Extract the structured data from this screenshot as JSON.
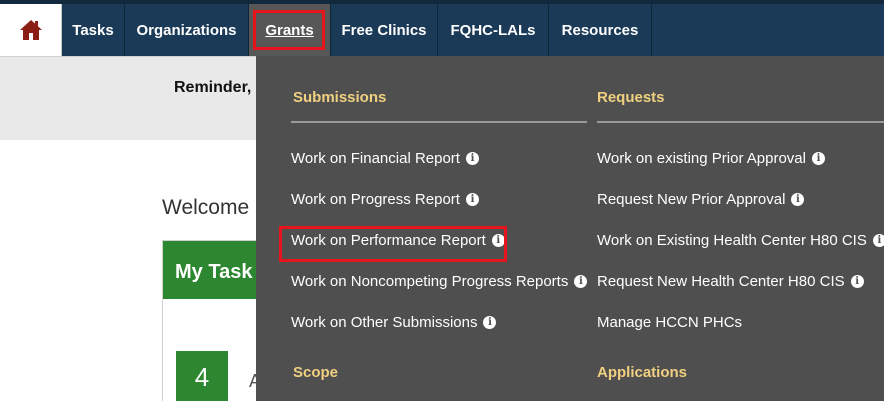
{
  "nav": {
    "home_icon": "home-icon",
    "items": [
      {
        "label": "Tasks"
      },
      {
        "label": "Organizations"
      },
      {
        "label": "Grants"
      },
      {
        "label": "Free Clinics"
      },
      {
        "label": "FQHC-LALs"
      },
      {
        "label": "Resources"
      }
    ],
    "active": "Grants",
    "colors": {
      "bar": "#1b3a57",
      "active": "#575757",
      "highlight": "#e8141c"
    }
  },
  "page": {
    "reminder": "Reminder,",
    "welcome": "Welcome",
    "tasks_card_title": "My Task",
    "task_count": "4",
    "task_count_next": "A",
    "card_color": "#2d8630"
  },
  "menu": {
    "submissions": {
      "heading": "Submissions",
      "items": [
        "Work on Financial Report",
        "Work on Progress Report",
        "Work on Performance Report",
        "Work on Noncompeting Progress Reports",
        "Work on Other Submissions"
      ]
    },
    "requests": {
      "heading": "Requests",
      "items": [
        "Work on existing Prior Approval",
        "Request New Prior Approval",
        "Work on Existing Health Center H80 CIS",
        "Request New Health Center H80 CIS",
        "Manage HCCN PHCs"
      ]
    },
    "scope": {
      "heading": "Scope"
    },
    "applications": {
      "heading": "Applications"
    },
    "info_icon": "info-icon",
    "highlighted_item": "Work on Performance Report",
    "heading_color": "#f0d080"
  }
}
